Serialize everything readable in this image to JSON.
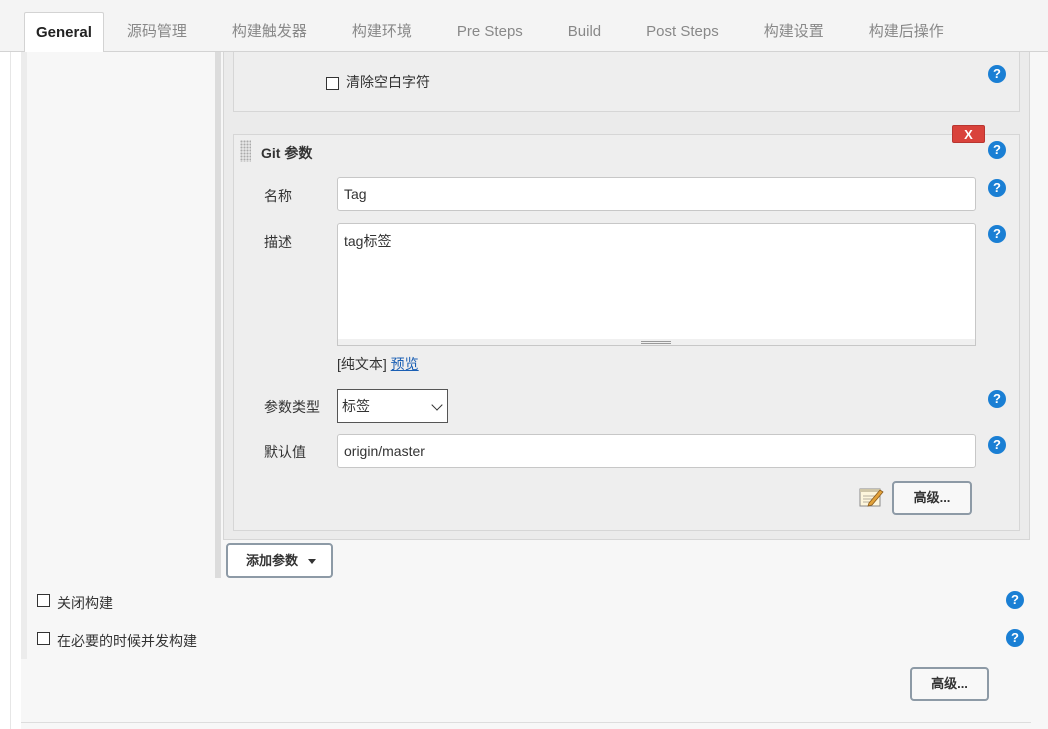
{
  "tabs": [
    {
      "label": "General",
      "active": true
    },
    {
      "label": "源码管理"
    },
    {
      "label": "构建触发器"
    },
    {
      "label": "构建环境"
    },
    {
      "label": "Pre Steps"
    },
    {
      "label": "Build"
    },
    {
      "label": "Post Steps"
    },
    {
      "label": "构建设置"
    },
    {
      "label": "构建后操作"
    }
  ],
  "prev_param": {
    "checkbox_label": "清除空白字符",
    "checked": false
  },
  "git_param": {
    "title": "Git 参数",
    "delete_label": "X",
    "name_label": "名称",
    "name_value": "Tag",
    "desc_label": "描述",
    "desc_value": "tag标签",
    "markup_prefix": "[纯文本]",
    "preview_link": "预览",
    "type_label": "参数类型",
    "type_value": "标签",
    "default_label": "默认值",
    "default_value": "origin/master",
    "advanced_label": "高级..."
  },
  "add_param_label": "添加参数",
  "general_options": [
    {
      "label": "关闭构建",
      "checked": false
    },
    {
      "label": "在必要的时候并发构建",
      "checked": false
    }
  ],
  "general_advanced_label": "高级...",
  "help_glyph": "?",
  "colors": {
    "accent_help": "#1a7fd4",
    "delete_red": "#d9423b",
    "link": "#1a5fb4"
  }
}
